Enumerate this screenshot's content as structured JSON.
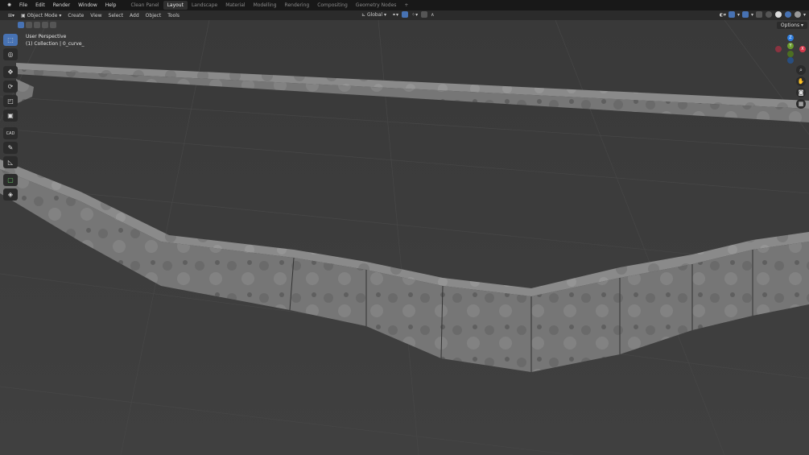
{
  "menu": [
    "File",
    "Edit",
    "Render",
    "Window",
    "Help"
  ],
  "workspaces": [
    "Clean Panel",
    "Layout",
    "Landscape",
    "Material",
    "Modelling",
    "Rendering",
    "Compositing",
    "Geometry Nodes"
  ],
  "active_workspace": "Layout",
  "add_workspace": "+",
  "header": {
    "mode": "Object Mode",
    "items": [
      "Create",
      "View",
      "Select",
      "Add",
      "Object",
      "Tools"
    ],
    "orientation": "Global",
    "options": "Options"
  },
  "viewport": {
    "perspective": "User Perspective",
    "collection": "(1) Collection | 0_curve_"
  },
  "gizmo": {
    "z": "Z",
    "y": "Y",
    "x": "X"
  },
  "tools": [
    "select-box",
    "cursor",
    "move",
    "rotate",
    "scale",
    "transform",
    "cad",
    "annotate",
    "measure",
    "add-cube",
    "transform-pivot"
  ],
  "colors": {
    "accent": "#4772b3",
    "x": "#d3374a",
    "y": "#6b9b2d",
    "z": "#2d7de0"
  }
}
